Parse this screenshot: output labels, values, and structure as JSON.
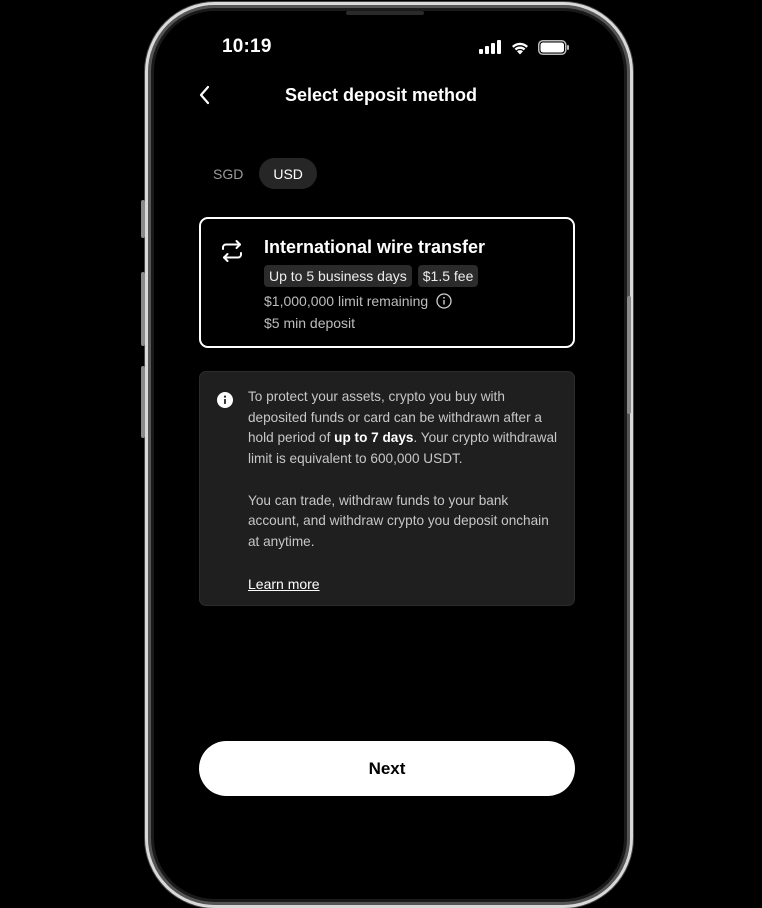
{
  "status_bar": {
    "time": "10:19"
  },
  "header": {
    "title": "Select deposit method"
  },
  "currency_tabs": [
    {
      "label": "SGD",
      "active": false
    },
    {
      "label": "USD",
      "active": true
    }
  ],
  "method": {
    "title": "International wire transfer",
    "tags": [
      "Up to 5 business days",
      "$1.5 fee"
    ],
    "limit": "$1,000,000 limit remaining",
    "min_deposit": "$5 min deposit",
    "icon": "transfer-arrows-icon"
  },
  "info": {
    "p1_before": "To protect your assets, crypto you buy with deposited funds or card can be withdrawn after a hold period of ",
    "p1_bold": "up to 7 days",
    "p1_after": ". Your crypto withdrawal limit is equivalent to 600,000 USDT.",
    "p2": "You can trade, withdraw funds to your bank account, and withdraw crypto you deposit onchain at anytime.",
    "learn_more": "Learn more"
  },
  "footer": {
    "next_label": "Next"
  },
  "colors": {
    "background": "#000000",
    "card_border": "#ffffff",
    "info_bg": "#1f1f1f",
    "button_bg": "#ffffff"
  }
}
